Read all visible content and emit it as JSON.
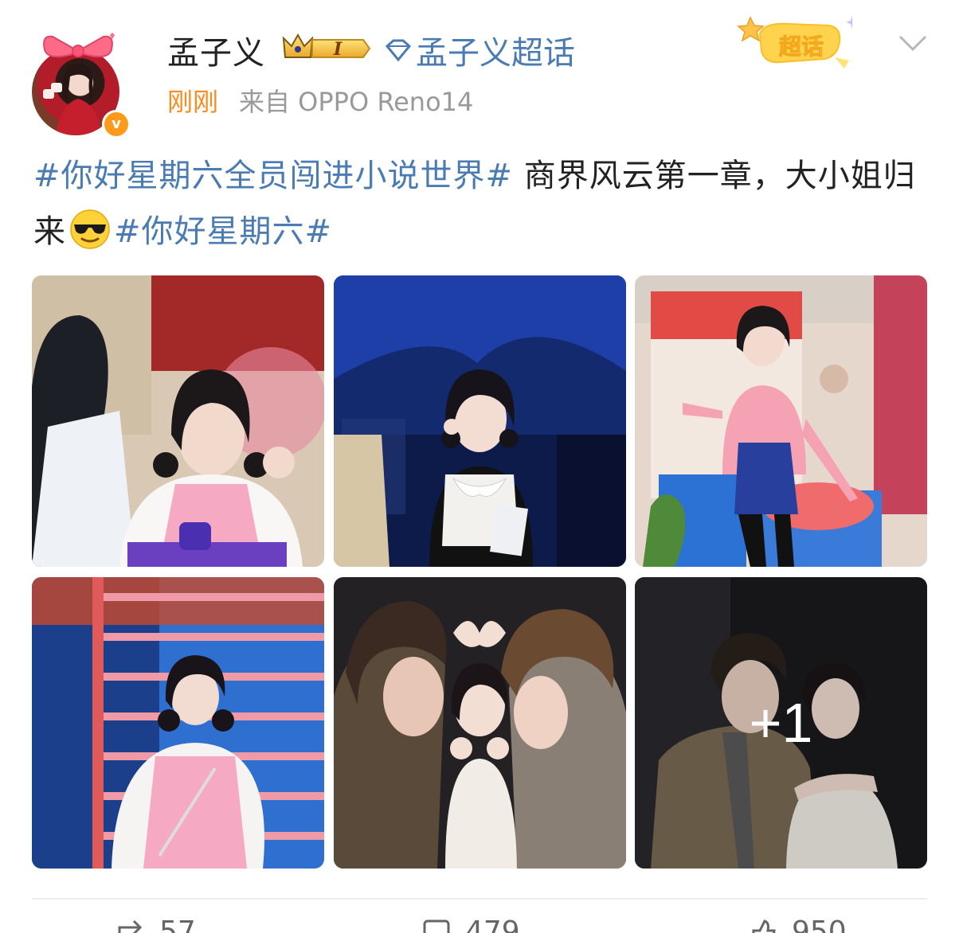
{
  "header": {
    "username": "孟子义",
    "badge_level": "I",
    "topic_link": "孟子义超话",
    "time": "刚刚",
    "source": "来自 OPPO Reno14",
    "supertopic_label": "超话"
  },
  "post": {
    "hashtag_1": "#你好星期六全员闯进小说世界#",
    "text_1": " 商界风云第一章，大小姐归来",
    "hashtag_2": "#你好星期六#"
  },
  "images": {
    "more_count": "+1"
  },
  "actions": {
    "repost_count": "57",
    "comment_count": "479",
    "like_count": "950"
  },
  "colors": {
    "link": "#4a7bb3",
    "time": "#ff8a1a",
    "badge_orange": "#ff9a1a"
  }
}
